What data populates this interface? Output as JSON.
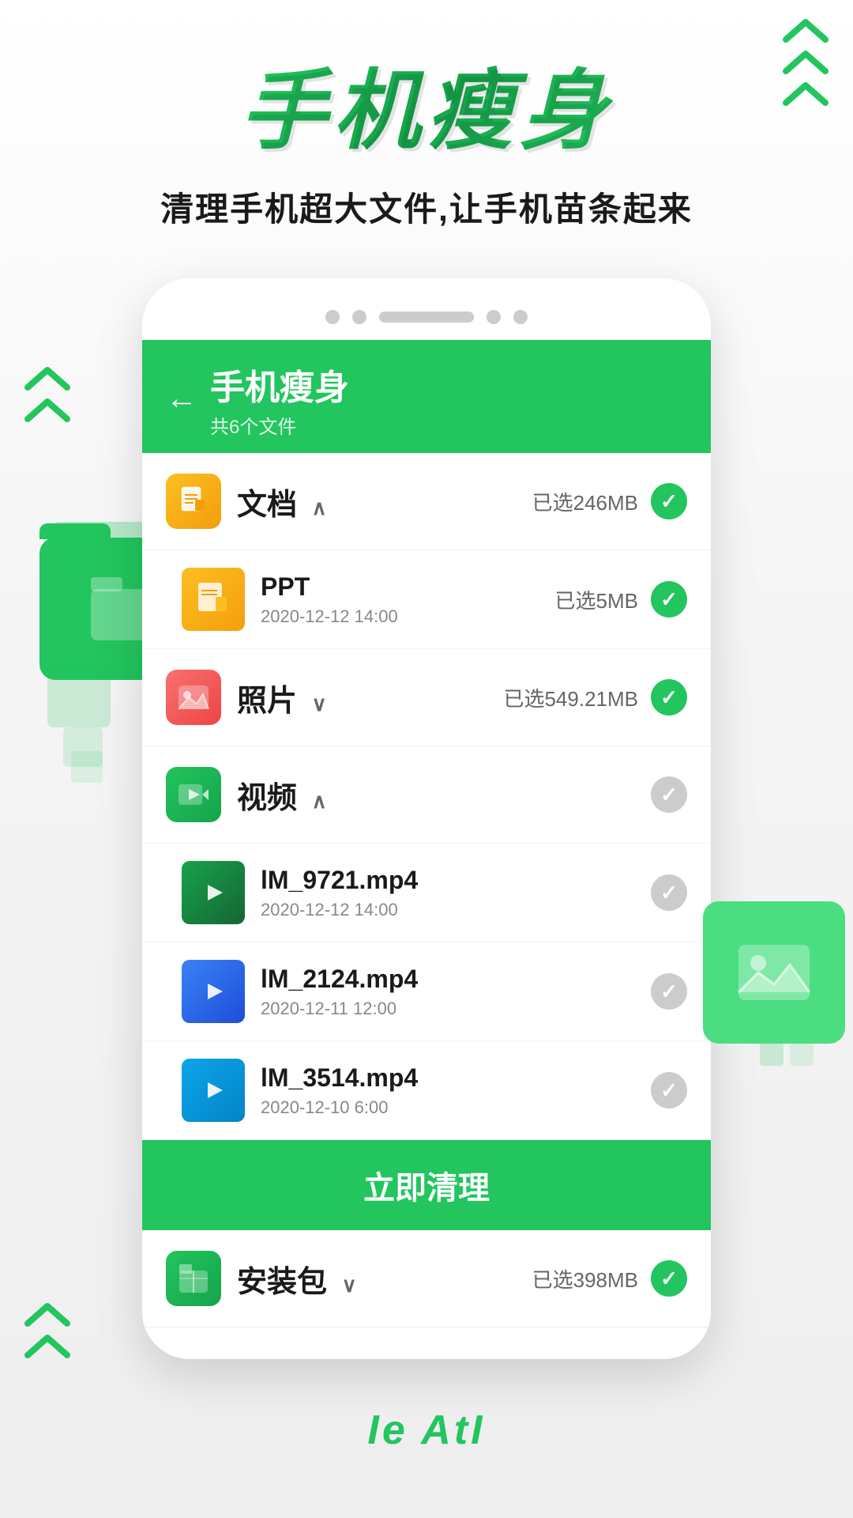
{
  "app": {
    "title": "手机瘦身",
    "subtitle": "清理手机超大文件,让手机苗条起来",
    "header": {
      "title": "手机瘦身",
      "file_count": "共6个文件",
      "back_label": "←"
    }
  },
  "colors": {
    "primary": "#22c55e",
    "primary_dark": "#16a34a",
    "text_dark": "#1a1a1a",
    "text_gray": "#666666",
    "text_light": "#888888"
  },
  "categories": [
    {
      "id": "docs",
      "name": "文档",
      "chevron": "∧",
      "size_label": "已选246MB",
      "checked": true,
      "icon_type": "doc"
    },
    {
      "id": "photos",
      "name": "照片",
      "chevron": "∨",
      "size_label": "已选549.21MB",
      "checked": true,
      "icon_type": "photo"
    },
    {
      "id": "videos",
      "name": "视频",
      "chevron": "∧",
      "size_label": "",
      "checked": false,
      "icon_type": "video"
    },
    {
      "id": "packages",
      "name": "安装包",
      "chevron": "∨",
      "size_label": "已选398MB",
      "checked": true,
      "icon_type": "package"
    }
  ],
  "files": [
    {
      "id": "ppt",
      "name": "PPT",
      "date": "2020-12-12 14:00",
      "size_label": "已选5MB",
      "checked": true,
      "thumb_type": "doc",
      "indent": true
    },
    {
      "id": "video1",
      "name": "lM_9721.mp4",
      "date": "2020-12-12 14:00",
      "size_label": "",
      "checked": false,
      "thumb_type": "video1",
      "indent": true
    },
    {
      "id": "video2",
      "name": "lM_2124.mp4",
      "date": "2020-12-11 12:00",
      "size_label": "",
      "checked": false,
      "thumb_type": "video2",
      "indent": true
    },
    {
      "id": "video3",
      "name": "lM_3514.mp4",
      "date": "2020-12-10 6:00",
      "size_label": "",
      "checked": false,
      "thumb_type": "video3",
      "indent": true
    }
  ],
  "clean_button": {
    "label": "立即清理"
  },
  "bottom_text": "Ie AtI",
  "phone_dots": [
    "",
    "",
    ""
  ],
  "decorations": {
    "chevrons_top_right": "»»",
    "chevrons_left": "»»",
    "chevrons_left_bottom": "»»"
  }
}
